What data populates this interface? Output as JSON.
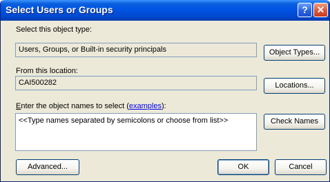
{
  "window": {
    "title": "Select Users or Groups",
    "help_glyph": "?",
    "close_glyph": "✕"
  },
  "object_type": {
    "label": "Select this object type:",
    "value": "Users, Groups, or Built-in security principals",
    "button": "Object Types..."
  },
  "location": {
    "label": "From this location:",
    "value": "CAI500282",
    "button": "Locations..."
  },
  "names": {
    "label_mnemonic": "E",
    "label_before": "nter the object names to select (",
    "label_link": "examples",
    "label_after": "):",
    "value": "<<Type names separated by semicolons or choose from list>>",
    "check_button": "Check Names"
  },
  "footer": {
    "advanced": "Advanced...",
    "ok": "OK",
    "cancel": "Cancel"
  }
}
